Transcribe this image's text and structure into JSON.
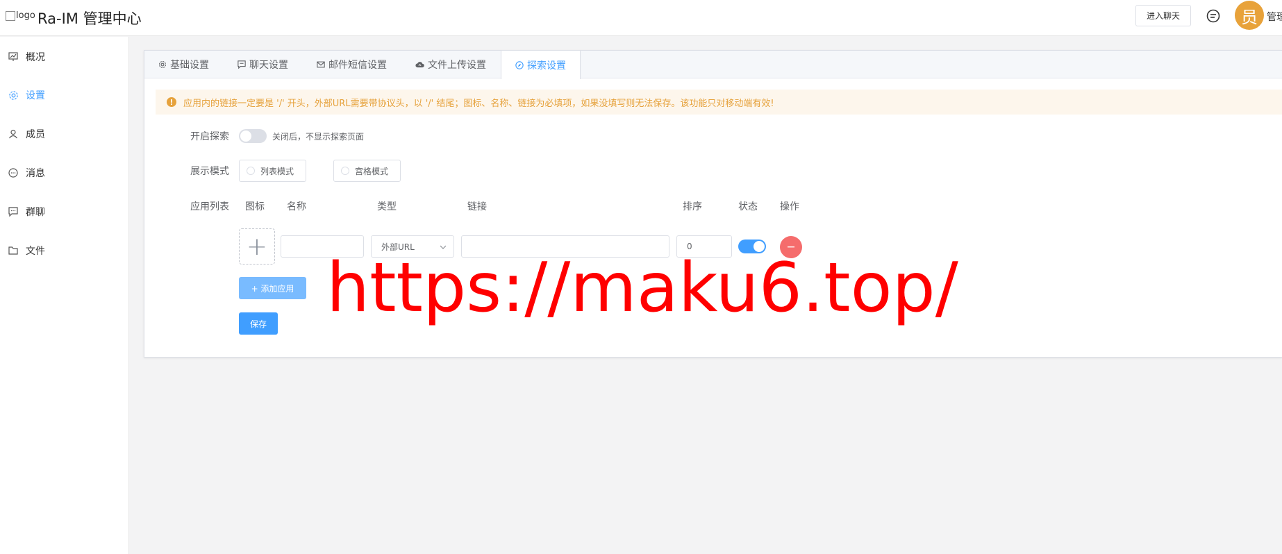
{
  "header": {
    "logo_alt": "logo",
    "title": "Ra-IM 管理中心",
    "enter_chat": "进入聊天",
    "avatar_char": "员",
    "user_name": "管理员"
  },
  "sidebar": {
    "items": [
      {
        "label": "概况",
        "icon": "chart-icon"
      },
      {
        "label": "设置",
        "icon": "gear-icon"
      },
      {
        "label": "成员",
        "icon": "user-icon"
      },
      {
        "label": "消息",
        "icon": "chat-bubble-icon"
      },
      {
        "label": "群聊",
        "icon": "group-chat-icon"
      },
      {
        "label": "文件",
        "icon": "folder-icon"
      }
    ],
    "active": "设置"
  },
  "tabs": [
    {
      "label": "基础设置",
      "icon": "gear-icon"
    },
    {
      "label": "聊天设置",
      "icon": "chat-icon"
    },
    {
      "label": "邮件短信设置",
      "icon": "mail-icon"
    },
    {
      "label": "文件上传设置",
      "icon": "cloud-upload-icon"
    },
    {
      "label": "探索设置",
      "icon": "compass-icon"
    }
  ],
  "active_tab": "探索设置",
  "alert": "应用内的链接一定要是 '/' 开头，外部URL需要带协议头，以 '/' 结尾；图标、名称、链接为必填项，如果没填写则无法保存。该功能只对移动端有效!",
  "form": {
    "enable_label": "开启探索",
    "enable_value": false,
    "enable_hint": "关闭后，不显示探索页面",
    "mode_label": "展示模式",
    "mode_options": [
      "列表模式",
      "宫格模式"
    ],
    "list_label": "应用列表",
    "columns": [
      "图标",
      "名称",
      "类型",
      "链接",
      "排序",
      "状态",
      "操作"
    ],
    "row": {
      "name": "",
      "type": "外部URL",
      "link": "",
      "order": "0",
      "status": true
    },
    "add_button": "+ 添加应用",
    "save_button": "保存"
  },
  "watermark": "https://maku6.top/",
  "colors": {
    "primary": "#409eff",
    "warning": "#e6a23c",
    "danger": "#f56c6c",
    "avatar": "#e8a23a",
    "watermark": "#ff0000"
  }
}
